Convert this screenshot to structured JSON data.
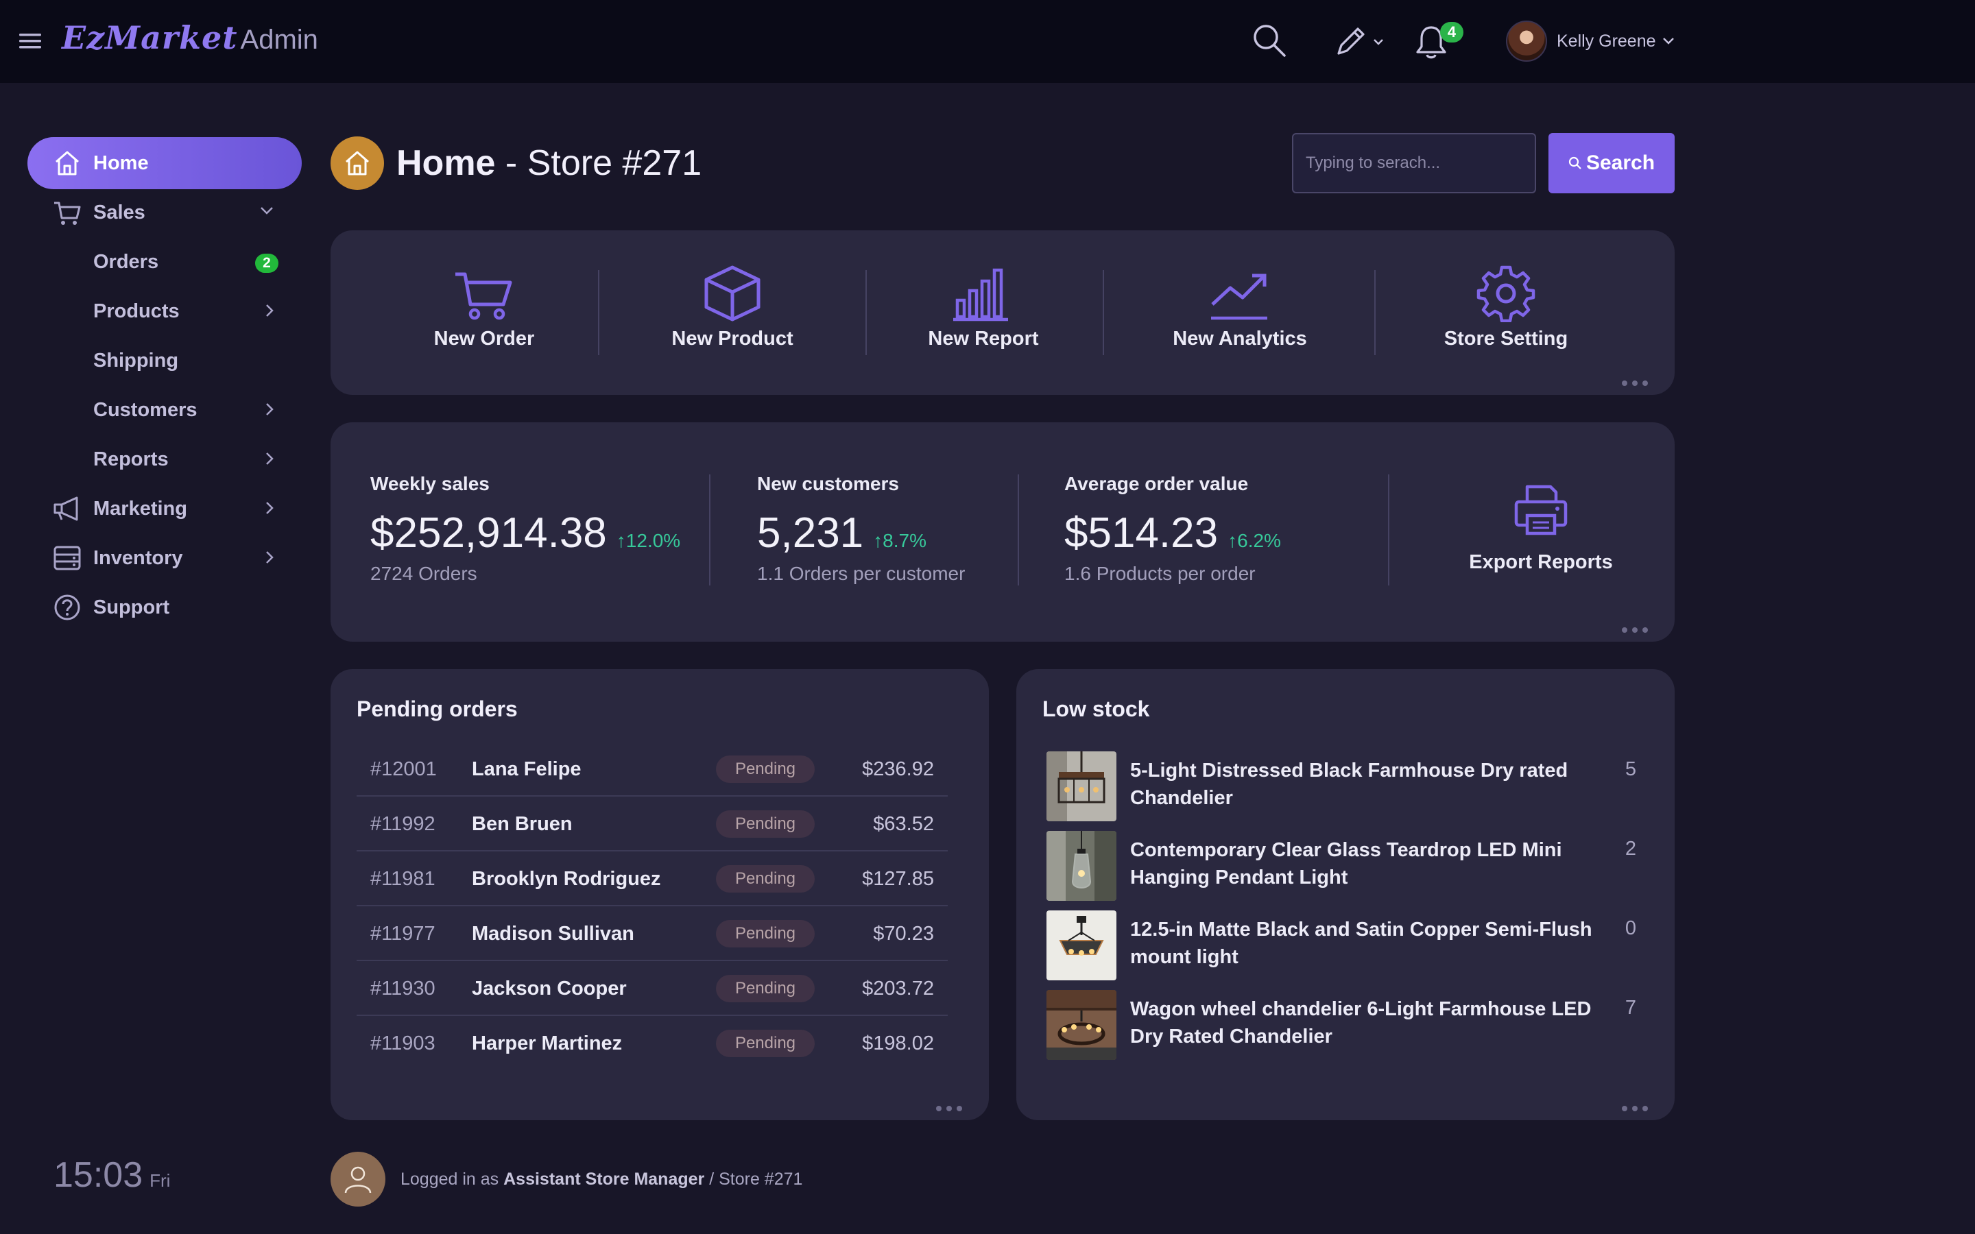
{
  "app": {
    "brand": "EzMarket",
    "suffix": "Admin"
  },
  "topbar": {
    "notifications_count": "4",
    "user_name": "Kelly Greene"
  },
  "sidebar": {
    "items": [
      {
        "label": "Home",
        "icon": "home-icon",
        "active": true
      },
      {
        "label": "Sales",
        "icon": "cart-icon",
        "expanded": true
      },
      {
        "label": "Orders",
        "badge": "2"
      },
      {
        "label": "Products"
      },
      {
        "label": "Shipping"
      },
      {
        "label": "Customers"
      },
      {
        "label": "Reports"
      },
      {
        "label": "Marketing",
        "icon": "megaphone-icon"
      },
      {
        "label": "Inventory",
        "icon": "storage-icon"
      },
      {
        "label": "Support",
        "icon": "help-icon"
      }
    ]
  },
  "clock": {
    "time": "15:03",
    "day": "Fri"
  },
  "page": {
    "title_bold": "Home",
    "title_rest": " - Store #271"
  },
  "search": {
    "placeholder": "Typing to serach...",
    "button_label": "Search"
  },
  "quick_actions": [
    {
      "label": "New Order",
      "icon": "cart-icon"
    },
    {
      "label": "New Product",
      "icon": "box-icon"
    },
    {
      "label": "New Report",
      "icon": "bar-chart-icon"
    },
    {
      "label": "New Analytics",
      "icon": "trend-icon"
    },
    {
      "label": "Store Setting",
      "icon": "gear-icon"
    }
  ],
  "stats": [
    {
      "title": "Weekly sales",
      "value": "$252,914.38",
      "delta": "12.0%",
      "sub": "2724 Orders"
    },
    {
      "title": "New customers",
      "value": "5,231",
      "delta": "8.7%",
      "sub": "1.1 Orders per customer"
    },
    {
      "title": "Average order value",
      "value": "$514.23",
      "delta": "6.2%",
      "sub": "1.6 Products per order"
    }
  ],
  "export": {
    "label": "Export Reports",
    "icon": "printer-icon"
  },
  "pending_orders": {
    "title": "Pending orders",
    "rows": [
      {
        "id": "#12001",
        "name": "Lana Felipe",
        "status": "Pending",
        "amount": "$236.92"
      },
      {
        "id": "#11992",
        "name": "Ben Bruen",
        "status": "Pending",
        "amount": "$63.52"
      },
      {
        "id": "#11981",
        "name": "Brooklyn Rodriguez",
        "status": "Pending",
        "amount": "$127.85"
      },
      {
        "id": "#11977",
        "name": "Madison Sullivan",
        "status": "Pending",
        "amount": "$70.23"
      },
      {
        "id": "#11930",
        "name": "Jackson Cooper",
        "status": "Pending",
        "amount": "$203.72"
      },
      {
        "id": "#11903",
        "name": "Harper Martinez",
        "status": "Pending",
        "amount": "$198.02"
      }
    ]
  },
  "low_stock": {
    "title": "Low stock",
    "rows": [
      {
        "name": "5-Light Distressed Black Farmhouse Dry rated Chandelier",
        "qty": "5"
      },
      {
        "name": "Contemporary Clear Glass Teardrop LED Mini Hanging Pendant Light",
        "qty": "2"
      },
      {
        "name": "12.5-in Matte Black and Satin Copper Semi-Flush mount light",
        "qty": "0"
      },
      {
        "name": "Wagon wheel chandelier 6-Light Farmhouse LED Dry Rated Chandelier",
        "qty": "7"
      }
    ]
  },
  "footer": {
    "prefix": "Logged in as ",
    "role": "Assistant Store Manager",
    "suffix": " / Store #271"
  },
  "colors": {
    "accent": "#7b5fe6",
    "background": "#181628",
    "card": "#2a283f",
    "topbar": "#0a0a17",
    "positive": "#37c99a",
    "badge_green": "#22b83b",
    "home_badge": "#c68a32"
  }
}
